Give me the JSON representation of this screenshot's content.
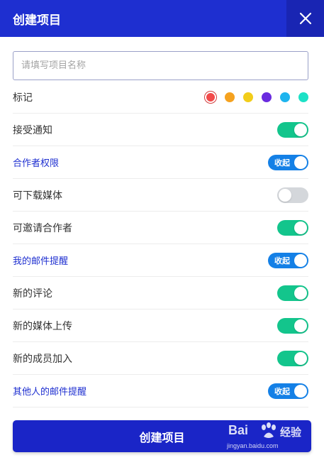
{
  "header": {
    "title": "创建项目"
  },
  "name_input": {
    "placeholder": "请填写项目名称",
    "value": ""
  },
  "tag": {
    "label": "标记",
    "colors": [
      "#f24a4a",
      "#f5a21f",
      "#f2cd1a",
      "#6a2bdf",
      "#1eb4ee",
      "#1de1c6"
    ],
    "selected": 0
  },
  "rows": [
    {
      "label": "接受通知",
      "type": "toggle",
      "on": true
    },
    {
      "label": "合作者权限",
      "type": "section",
      "collapse_label": "收起"
    },
    {
      "label": "可下载媒体",
      "type": "toggle",
      "on": false
    },
    {
      "label": "可邀请合作者",
      "type": "toggle",
      "on": true
    },
    {
      "label": "我的邮件提醒",
      "type": "section",
      "collapse_label": "收起"
    },
    {
      "label": "新的评论",
      "type": "toggle",
      "on": true
    },
    {
      "label": "新的媒体上传",
      "type": "toggle",
      "on": true
    },
    {
      "label": "新的成员加入",
      "type": "toggle",
      "on": true
    },
    {
      "label": "其他人的邮件提醒",
      "type": "section",
      "collapse_label": "收起"
    }
  ],
  "submit": {
    "label": "创建项目"
  },
  "watermark": {
    "logo": "Bai",
    "name": "经验",
    "url": "jingyan.baidu.com"
  },
  "theme": {
    "primary": "#1e2fd0",
    "toggle_on": "#13c58c",
    "toggle_off": "#d4d7db",
    "collapse": "#1480e6"
  }
}
